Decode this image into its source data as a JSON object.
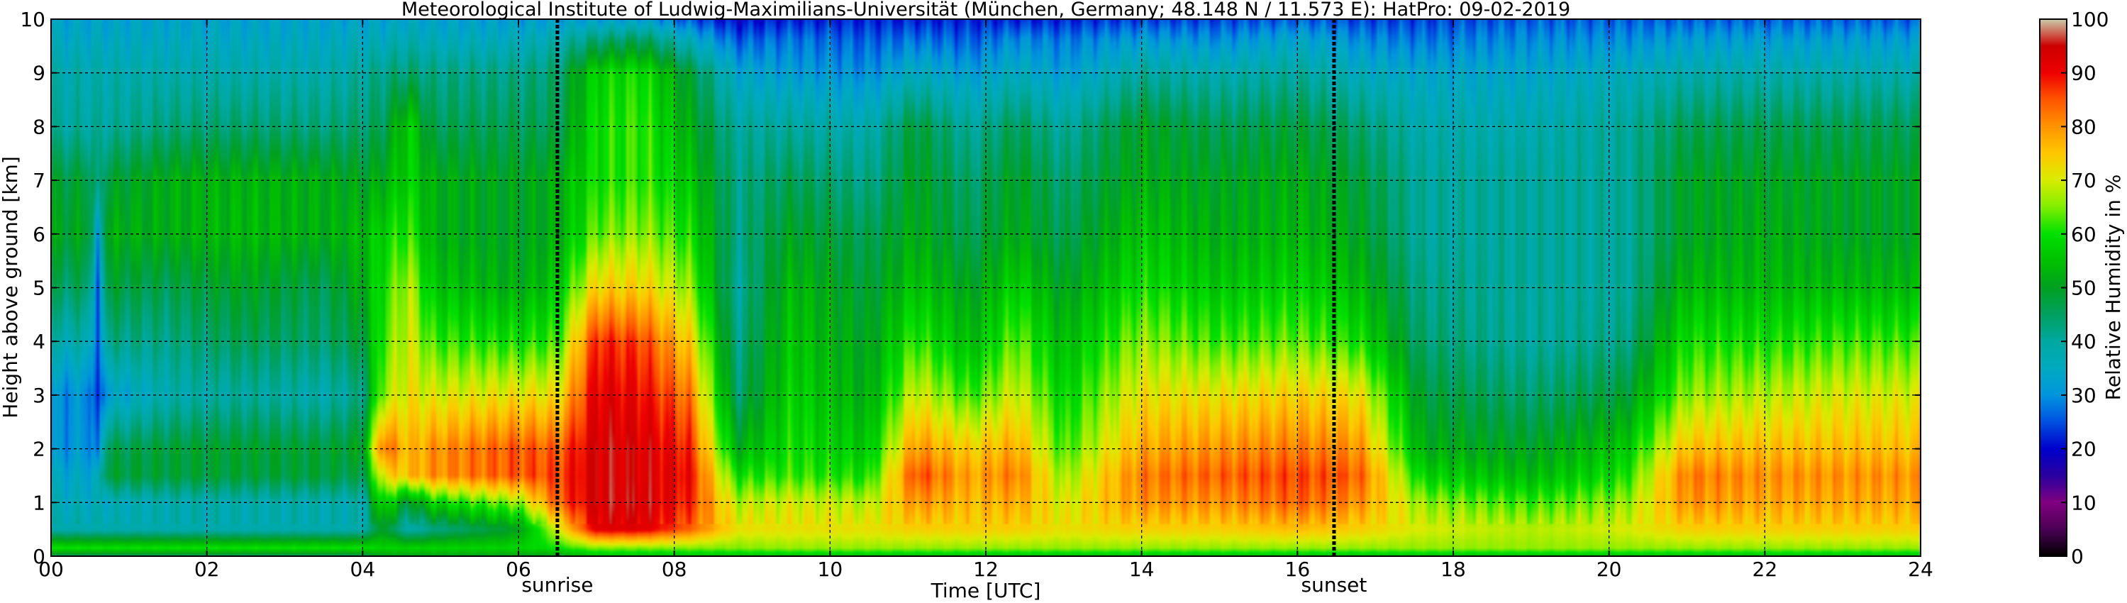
{
  "chart_data": {
    "type": "heatmap",
    "title": "Meteorological Institute of Ludwig-Maximilians-Universität (München, Germany; 48.148 N / 11.573 E):    HatPro: 09-02-2019",
    "xlabel": "Time [UTC]",
    "ylabel": "Height above ground [km]",
    "xlim": [
      0,
      24
    ],
    "ylim": [
      0,
      10
    ],
    "x_ticks": [
      "00",
      "02",
      "04",
      "06",
      "08",
      "10",
      "12",
      "14",
      "16",
      "18",
      "20",
      "22",
      "24"
    ],
    "y_ticks": [
      "0",
      "1",
      "2",
      "3",
      "4",
      "5",
      "6",
      "7",
      "8",
      "9",
      "10"
    ],
    "grid": true,
    "markers": [
      {
        "label": "sunrise",
        "x": 6.5
      },
      {
        "label": "sunset",
        "x": 16.47
      }
    ],
    "colorbar": {
      "label": "Relative Humidity in %",
      "range": [
        0,
        100
      ],
      "ticks": [
        "0",
        "10",
        "20",
        "30",
        "40",
        "50",
        "60",
        "70",
        "80",
        "90",
        "100"
      ],
      "stops": [
        {
          "v": 0,
          "c": "#000000"
        },
        {
          "v": 5,
          "c": "#4b0055"
        },
        {
          "v": 10,
          "c": "#800080"
        },
        {
          "v": 15,
          "c": "#2a00a0"
        },
        {
          "v": 20,
          "c": "#0000cc"
        },
        {
          "v": 25,
          "c": "#0050e0"
        },
        {
          "v": 30,
          "c": "#0095dd"
        },
        {
          "v": 35,
          "c": "#00aac0"
        },
        {
          "v": 40,
          "c": "#00a8a0"
        },
        {
          "v": 45,
          "c": "#00a060"
        },
        {
          "v": 50,
          "c": "#00a020"
        },
        {
          "v": 55,
          "c": "#00c000"
        },
        {
          "v": 60,
          "c": "#00e000"
        },
        {
          "v": 65,
          "c": "#80ee00"
        },
        {
          "v": 70,
          "c": "#d8ec00"
        },
        {
          "v": 75,
          "c": "#ffc800"
        },
        {
          "v": 80,
          "c": "#ff9400"
        },
        {
          "v": 85,
          "c": "#ff5500"
        },
        {
          "v": 90,
          "c": "#ee0000"
        },
        {
          "v": 95,
          "c": "#cc0000"
        },
        {
          "v": 100,
          "c": "#ccccaa"
        }
      ]
    },
    "field_keyframes": {
      "heights": [
        0,
        0.15,
        0.5,
        1,
        1.5,
        2,
        3,
        4,
        5,
        6,
        7,
        8,
        9,
        9.6,
        10
      ],
      "columns": [
        {
          "t": 0.0,
          "rh": [
            45,
            60,
            38,
            36,
            34,
            30,
            30,
            38,
            45,
            50,
            48,
            40,
            38,
            35,
            33
          ]
        },
        {
          "t": 0.5,
          "rh": [
            45,
            60,
            38,
            36,
            34,
            31,
            30,
            38,
            45,
            50,
            48,
            40,
            38,
            35,
            33
          ]
        },
        {
          "t": 0.6,
          "rh": [
            45,
            60,
            38,
            36,
            34,
            25,
            20,
            22,
            22,
            28,
            40,
            40,
            38,
            35,
            33
          ]
        },
        {
          "t": 0.7,
          "rh": [
            45,
            60,
            38,
            36,
            48,
            46,
            32,
            42,
            48,
            52,
            48,
            40,
            38,
            35,
            33
          ]
        },
        {
          "t": 1.5,
          "rh": [
            45,
            60,
            38,
            38,
            48,
            48,
            38,
            42,
            46,
            52,
            52,
            43,
            38,
            35,
            33
          ]
        },
        {
          "t": 2.5,
          "rh": [
            45,
            60,
            38,
            38,
            48,
            49,
            40,
            46,
            50,
            54,
            53,
            44,
            38,
            35,
            33
          ]
        },
        {
          "t": 3.5,
          "rh": [
            45,
            60,
            38,
            38,
            48,
            48,
            38,
            44,
            46,
            52,
            52,
            43,
            38,
            35,
            33
          ]
        },
        {
          "t": 4.0,
          "rh": [
            45,
            60,
            38,
            38,
            46,
            50,
            42,
            48,
            52,
            54,
            50,
            44,
            40,
            36,
            33
          ]
        },
        {
          "t": 4.25,
          "rh": [
            50,
            58,
            50,
            60,
            72,
            84,
            66,
            62,
            60,
            58,
            52,
            46,
            42,
            36,
            33
          ]
        },
        {
          "t": 4.6,
          "rh": [
            50,
            58,
            38,
            48,
            76,
            76,
            72,
            70,
            68,
            62,
            58,
            58,
            44,
            38,
            34
          ]
        },
        {
          "t": 4.9,
          "rh": [
            50,
            58,
            42,
            58,
            80,
            80,
            70,
            62,
            56,
            52,
            52,
            46,
            42,
            36,
            33
          ]
        },
        {
          "t": 6.0,
          "rh": [
            50,
            58,
            50,
            66,
            85,
            85,
            72,
            60,
            52,
            50,
            50,
            46,
            42,
            36,
            32
          ]
        },
        {
          "t": 6.5,
          "rh": [
            50,
            60,
            70,
            84,
            86,
            84,
            72,
            62,
            56,
            52,
            52,
            46,
            44,
            38,
            32
          ]
        },
        {
          "t": 7.0,
          "rh": [
            55,
            65,
            92,
            94,
            94,
            94,
            92,
            88,
            74,
            64,
            60,
            60,
            58,
            44,
            32
          ]
        },
        {
          "t": 7.6,
          "rh": [
            55,
            65,
            92,
            94,
            93,
            93,
            90,
            86,
            74,
            66,
            62,
            62,
            60,
            46,
            32
          ]
        },
        {
          "t": 8.2,
          "rh": [
            55,
            65,
            84,
            88,
            90,
            88,
            82,
            74,
            66,
            60,
            56,
            52,
            48,
            36,
            25
          ]
        },
        {
          "t": 8.8,
          "rh": [
            55,
            65,
            72,
            68,
            60,
            52,
            44,
            42,
            40,
            42,
            42,
            40,
            34,
            26,
            20
          ]
        },
        {
          "t": 9.5,
          "rh": [
            55,
            66,
            72,
            70,
            62,
            60,
            58,
            56,
            54,
            50,
            46,
            40,
            32,
            28,
            22
          ]
        },
        {
          "t": 10.5,
          "rh": [
            55,
            66,
            72,
            68,
            60,
            56,
            52,
            50,
            48,
            46,
            42,
            38,
            30,
            26,
            22
          ]
        },
        {
          "t": 11.1,
          "rh": [
            55,
            66,
            74,
            80,
            86,
            80,
            70,
            62,
            56,
            52,
            50,
            48,
            36,
            28,
            22
          ]
        },
        {
          "t": 11.8,
          "rh": [
            55,
            66,
            74,
            76,
            78,
            74,
            62,
            54,
            50,
            46,
            44,
            40,
            32,
            26,
            22
          ]
        },
        {
          "t": 12.4,
          "rh": [
            55,
            66,
            74,
            78,
            82,
            78,
            70,
            64,
            58,
            52,
            50,
            46,
            36,
            30,
            22
          ]
        },
        {
          "t": 13.0,
          "rh": [
            55,
            66,
            72,
            70,
            66,
            62,
            58,
            54,
            50,
            46,
            44,
            40,
            32,
            28,
            22
          ]
        },
        {
          "t": 14.0,
          "rh": [
            55,
            66,
            74,
            80,
            82,
            78,
            72,
            66,
            60,
            56,
            52,
            50,
            40,
            32,
            24
          ]
        },
        {
          "t": 15.0,
          "rh": [
            55,
            66,
            74,
            80,
            84,
            80,
            72,
            62,
            56,
            52,
            50,
            46,
            38,
            30,
            24
          ]
        },
        {
          "t": 16.0,
          "rh": [
            55,
            66,
            76,
            84,
            86,
            82,
            74,
            64,
            58,
            54,
            52,
            48,
            40,
            34,
            26
          ]
        },
        {
          "t": 16.8,
          "rh": [
            55,
            66,
            74,
            80,
            84,
            80,
            72,
            60,
            54,
            50,
            48,
            44,
            36,
            30,
            24
          ]
        },
        {
          "t": 17.6,
          "rh": [
            55,
            66,
            70,
            66,
            58,
            52,
            48,
            44,
            42,
            40,
            40,
            38,
            34,
            28,
            24
          ]
        },
        {
          "t": 19.0,
          "rh": [
            55,
            66,
            68,
            62,
            54,
            50,
            44,
            40,
            40,
            40,
            40,
            38,
            34,
            30,
            26
          ]
        },
        {
          "t": 20.2,
          "rh": [
            55,
            66,
            70,
            66,
            60,
            56,
            48,
            42,
            40,
            40,
            40,
            40,
            36,
            30,
            26
          ]
        },
        {
          "t": 21.0,
          "rh": [
            55,
            66,
            74,
            80,
            82,
            76,
            66,
            60,
            54,
            50,
            50,
            46,
            38,
            32,
            26
          ]
        },
        {
          "t": 22.0,
          "rh": [
            55,
            66,
            74,
            78,
            80,
            76,
            68,
            60,
            54,
            52,
            50,
            46,
            38,
            32,
            26
          ]
        },
        {
          "t": 23.0,
          "rh": [
            55,
            66,
            74,
            78,
            80,
            76,
            70,
            62,
            54,
            50,
            50,
            46,
            38,
            32,
            26
          ]
        },
        {
          "t": 24.0,
          "rh": [
            55,
            66,
            74,
            78,
            80,
            76,
            70,
            62,
            54,
            50,
            50,
            46,
            38,
            32,
            26
          ]
        }
      ]
    }
  }
}
